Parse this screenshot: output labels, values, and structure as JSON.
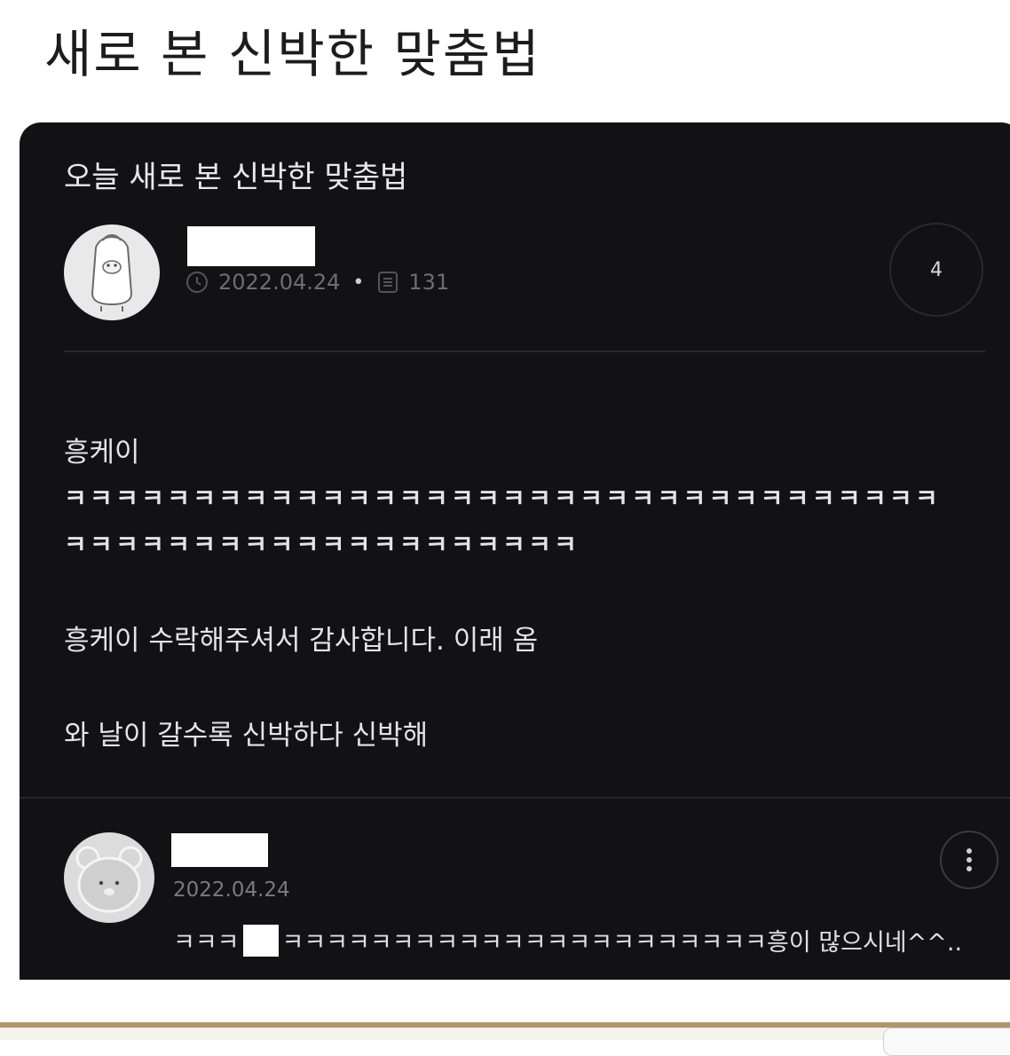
{
  "heading": "새로 본 신박한 맞춤법",
  "post": {
    "title": "오늘 새로 본 신박한 맞춤법",
    "date": "2022.04.24",
    "views": "131",
    "comment_count": "4",
    "lines": [
      "흥케이",
      "ㅋㅋㅋㅋㅋㅋㅋㅋㅋㅋㅋㅋㅋㅋㅋㅋㅋㅋㅋㅋㅋㅋㅋㅋㅋㅋㅋㅋㅋㅋㅋㅋㅋㅋ",
      "ㅋㅋㅋㅋㅋㅋㅋㅋㅋㅋㅋㅋㅋㅋㅋㅋㅋㅋㅋㅋ",
      "흥케이 수락해주셔서 감사합니다. 이래 옴",
      "와 날이 갈수록 신박하다 신박해"
    ]
  },
  "comment": {
    "date": "2022.04.24",
    "text_start": "ㅋㅋㅋ",
    "text_end": "ㅋㅋㅋㅋㅋㅋㅋㅋㅋㅋㅋㅋㅋㅋㅋㅋㅋㅋㅋㅋㅋㅋ흥이 많으시네^^.."
  }
}
